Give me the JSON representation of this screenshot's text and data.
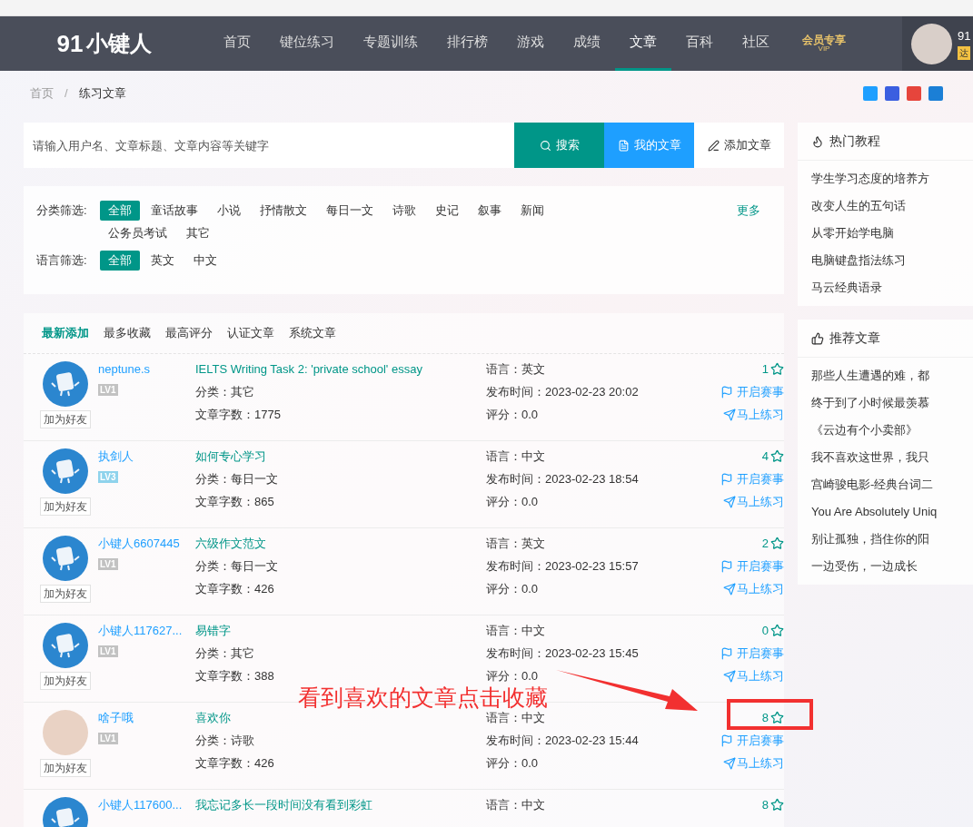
{
  "nav": {
    "logo": {
      "digits": "91",
      "name": "小键人"
    },
    "items": [
      {
        "label": "首页",
        "selected": false
      },
      {
        "label": "键位练习",
        "selected": false
      },
      {
        "label": "专题训练",
        "selected": false
      },
      {
        "label": "排行榜",
        "selected": false
      },
      {
        "label": "游戏",
        "selected": false
      },
      {
        "label": "成绩",
        "selected": false
      },
      {
        "label": "文章",
        "selected": true
      },
      {
        "label": "百科",
        "selected": false
      },
      {
        "label": "社区",
        "selected": false
      }
    ],
    "vip": {
      "label": "会员专享",
      "sub": "VIP"
    },
    "user": {
      "name": "91",
      "badge": "达"
    }
  },
  "breadcrumb": [
    "首页",
    "练习文章"
  ],
  "breadcrumb_separator": "/",
  "search": {
    "placeholder": "请输入用户名、文章标题、文章内容等关键字",
    "buttons": [
      {
        "kind": "search",
        "label": "搜索"
      },
      {
        "kind": "mine",
        "label": "我的文章"
      },
      {
        "kind": "add",
        "label": "添加文章"
      }
    ]
  },
  "filters": {
    "category_label": "分类筛选:",
    "categories": [
      {
        "label": "全部",
        "selected": true
      },
      {
        "label": "童话故事",
        "selected": false
      },
      {
        "label": "小说",
        "selected": false
      },
      {
        "label": "抒情散文",
        "selected": false
      },
      {
        "label": "每日一文",
        "selected": false
      },
      {
        "label": "诗歌",
        "selected": false
      },
      {
        "label": "史记",
        "selected": false
      },
      {
        "label": "叙事",
        "selected": false
      },
      {
        "label": "新闻",
        "selected": false
      },
      {
        "label": "公务员考试",
        "selected": false
      },
      {
        "label": "其它",
        "selected": false
      }
    ],
    "more": "更多",
    "language_label": "语言筛选:",
    "languages": [
      {
        "label": "全部",
        "selected": true
      },
      {
        "label": "英文",
        "selected": false
      },
      {
        "label": "中文",
        "selected": false
      }
    ]
  },
  "sort_tabs": [
    {
      "label": "最新添加",
      "selected": true
    },
    {
      "label": "最多收藏",
      "selected": false
    },
    {
      "label": "最高评分",
      "selected": false
    },
    {
      "label": "认证文章",
      "selected": false
    },
    {
      "label": "系统文章",
      "selected": false
    }
  ],
  "articles": [
    {
      "user": "neptune.s",
      "custom_avatar": false,
      "level": "LV1",
      "color": "#c2c2c2",
      "add_friend": "加为好友",
      "title": "IELTS Writing Task 2: 'private school' essay",
      "category": "分类：其它",
      "words": "文章字数：1775",
      "language": "语言：英文",
      "time": "发布时间：2023-02-23 20:02",
      "score": "评分：0.0",
      "favorites": "1",
      "contest": "开启赛事",
      "practice": "马上练习"
    },
    {
      "user": "执剑人",
      "custom_avatar": false,
      "level": "LV3",
      "color": "#8fd3ec",
      "add_friend": "加为好友",
      "title": "如何专心学习",
      "category": "分类：每日一文",
      "words": "文章字数：865",
      "language": "语言：中文",
      "time": "发布时间：2023-02-23 18:54",
      "score": "评分：0.0",
      "favorites": "4",
      "contest": "开启赛事",
      "practice": "马上练习"
    },
    {
      "user": "小键人6607445",
      "custom_avatar": false,
      "level": "LV1",
      "color": "#c2c2c2",
      "add_friend": "加为好友",
      "title": "六级作文范文",
      "category": "分类：每日一文",
      "words": "文章字数：426",
      "language": "语言：英文",
      "time": "发布时间：2023-02-23 15:57",
      "score": "评分：0.0",
      "favorites": "2",
      "contest": "开启赛事",
      "practice": "马上练习"
    },
    {
      "user": "小键人117627...",
      "custom_avatar": false,
      "level": "LV1",
      "color": "#c2c2c2",
      "add_friend": "加为好友",
      "title": "易错字",
      "category": "分类：其它",
      "words": "文章字数：388",
      "language": "语言：中文",
      "time": "发布时间：2023-02-23 15:45",
      "score": "评分：0.0",
      "favorites": "0",
      "contest": "开启赛事",
      "practice": "马上练习"
    },
    {
      "user": "啥子哦",
      "custom_avatar": true,
      "level": "LV1",
      "color": "#c2c2c2",
      "add_friend": "加为好友",
      "title": "喜欢你",
      "category": "分类：诗歌",
      "words": "文章字数：426",
      "language": "语言：中文",
      "time": "发布时间：2023-02-23 15:44",
      "score": "评分：0.0",
      "favorites": "8",
      "contest": "开启赛事",
      "practice": "马上练习"
    },
    {
      "user": "小键人117600...",
      "custom_avatar": false,
      "title": "我忘记多长一段时间没有看到彩虹",
      "language": "语言：中文",
      "favorites": "8"
    }
  ],
  "sidebar": [
    {
      "kind": "hot",
      "title": "热门教程",
      "items": [
        "学生学习态度的培养方",
        "改变人生的五句话",
        "从零开始学电脑",
        "电脑键盘指法练习",
        "马云经典语录"
      ]
    },
    {
      "kind": "recommend",
      "title": "推荐文章",
      "items": [
        "那些人生遭遇的难，都",
        "终于到了小时候最羡慕",
        "《云边有个小卖部》",
        "我不喜欢这世界，我只",
        "宫崎骏电影-经典台词二",
        "You Are Absolutely Uniq",
        "别让孤独，挡住你的阳",
        "一边受伤，一边成长"
      ]
    }
  ],
  "annotation": {
    "text": "看到喜欢的文章点击收藏"
  }
}
